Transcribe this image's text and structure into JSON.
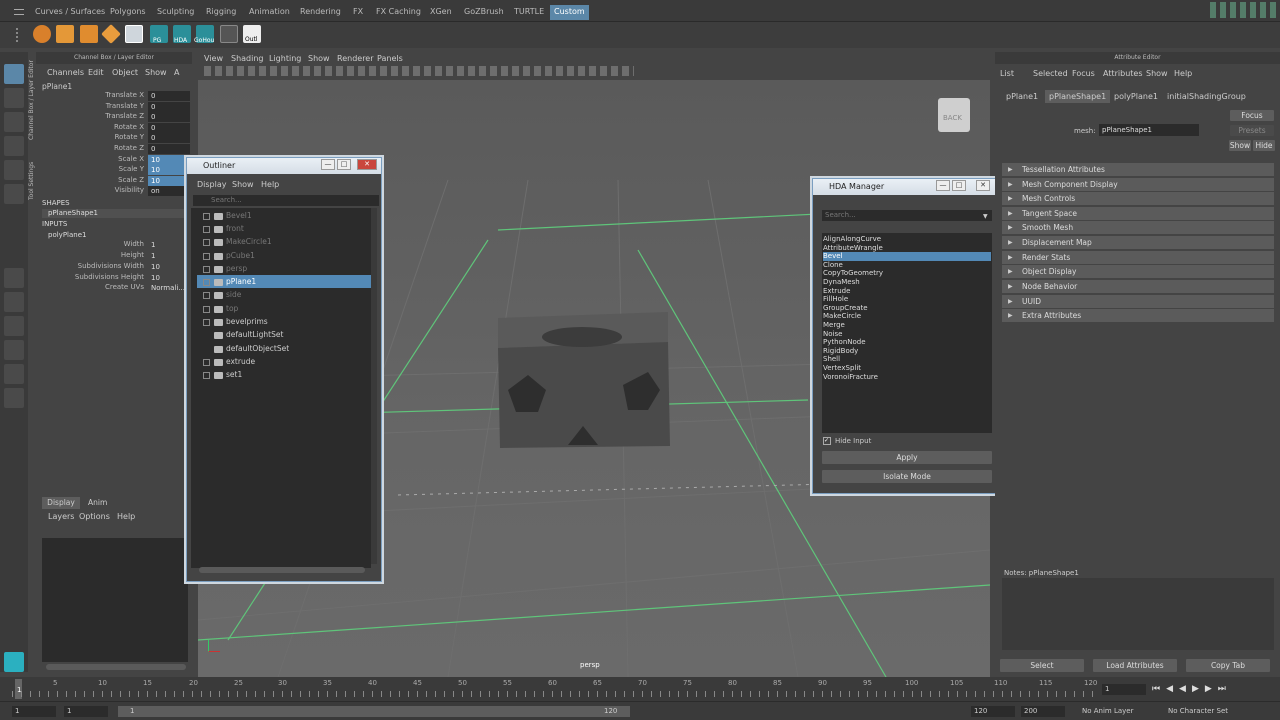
{
  "shelf": {
    "tabs": [
      "Curves / Surfaces",
      "Polygons",
      "Sculpting",
      "Rigging",
      "Animation",
      "Rendering",
      "FX",
      "FX Caching",
      "XGen",
      "GoZBrush",
      "TURTLE",
      "Custom"
    ],
    "icon_labels": {
      "pg": "PG",
      "hda": "HDA",
      "gohou": "GoHou",
      "outl": "Outl"
    }
  },
  "channel_box": {
    "header": "Channel Box / Layer Editor",
    "menu": [
      "Channels",
      "Edit",
      "Object",
      "Show",
      "A"
    ],
    "object": "pPlane1",
    "attrs": [
      {
        "label": "Translate X",
        "value": "0"
      },
      {
        "label": "Translate Y",
        "value": "0"
      },
      {
        "label": "Translate Z",
        "value": "0"
      },
      {
        "label": "Rotate X",
        "value": "0"
      },
      {
        "label": "Rotate Y",
        "value": "0"
      },
      {
        "label": "Rotate Z",
        "value": "0"
      },
      {
        "label": "Scale X",
        "value": "10"
      },
      {
        "label": "Scale Y",
        "value": "10"
      },
      {
        "label": "Scale Z",
        "value": "10"
      },
      {
        "label": "Visibility",
        "value": "on"
      }
    ],
    "shapes_label": "SHAPES",
    "shape_name": "pPlaneShape1",
    "inputs_label": "INPUTS",
    "input_name": "polyPlane1",
    "input_attrs": [
      {
        "label": "Width",
        "value": "1"
      },
      {
        "label": "Height",
        "value": "1"
      },
      {
        "label": "Subdivisions Width",
        "value": "10"
      },
      {
        "label": "Subdivisions Height",
        "value": "10"
      },
      {
        "label": "Create UVs",
        "value": "Normali..."
      }
    ],
    "layer_tabs": [
      "Display",
      "Anim"
    ],
    "layer_menu": [
      "Layers",
      "Options",
      "Help"
    ],
    "side_tabs": "Channel Box / Layer Editor",
    "tool_settings": "Tool Settings"
  },
  "viewport": {
    "menu": [
      "View",
      "Shading",
      "Lighting",
      "Show",
      "Renderer",
      "Panels"
    ],
    "camera": "persp",
    "cube_label": "BACK"
  },
  "outliner": {
    "title": "Outliner",
    "menu": [
      "Display",
      "Show",
      "Help"
    ],
    "search_placeholder": "Search...",
    "items": [
      {
        "name": "Bevel1",
        "state": "dim"
      },
      {
        "name": "front",
        "state": "dim"
      },
      {
        "name": "MakeCircle1",
        "state": "dim"
      },
      {
        "name": "pCube1",
        "state": "dim"
      },
      {
        "name": "persp",
        "state": "dim"
      },
      {
        "name": "pPlane1",
        "state": "sel"
      },
      {
        "name": "side",
        "state": "dim"
      },
      {
        "name": "top",
        "state": "dim"
      },
      {
        "name": "bevelprims",
        "state": ""
      },
      {
        "name": "defaultLightSet",
        "state": ""
      },
      {
        "name": "defaultObjectSet",
        "state": ""
      },
      {
        "name": "extrude",
        "state": ""
      },
      {
        "name": "set1",
        "state": ""
      }
    ]
  },
  "hda": {
    "title": "HDA Manager",
    "search_placeholder": "Search...",
    "items": [
      "AlignAlongCurve",
      "AttributeWrangle",
      "Bevel",
      "Clone",
      "CopyToGeometry",
      "DynaMesh",
      "Extrude",
      "FillHole",
      "GroupCreate",
      "MakeCircle",
      "Merge",
      "Noise",
      "PythonNode",
      "RigidBody",
      "Shell",
      "VertexSplit",
      "VoronoiFracture"
    ],
    "selected": "Bevel",
    "hide_input": "Hide Input",
    "apply": "Apply",
    "isolate": "Isolate Mode"
  },
  "attr_editor": {
    "header": "Attribute Editor",
    "menu": [
      "List",
      "Selected",
      "Focus",
      "Attributes",
      "Show",
      "Help"
    ],
    "tabs": [
      "pPlane1",
      "pPlaneShape1",
      "polyPlane1",
      "initialShadingGroup"
    ],
    "mesh_label": "mesh:",
    "mesh_value": "pPlaneShape1",
    "focus": "Focus",
    "presets": "Presets",
    "show": "Show",
    "hide": "Hide",
    "sections": [
      "Tessellation Attributes",
      "Mesh Component Display",
      "Mesh Controls",
      "Tangent Space",
      "Smooth Mesh",
      "Displacement Map",
      "Render Stats",
      "Object Display",
      "Node Behavior",
      "UUID",
      "Extra Attributes"
    ],
    "notes": "Notes:  pPlaneShape1",
    "buttons": [
      "Select",
      "Load Attributes",
      "Copy Tab"
    ]
  },
  "timeline": {
    "ticks": [
      "5",
      "10",
      "15",
      "20",
      "25",
      "30",
      "35",
      "40",
      "45",
      "50",
      "55",
      "60",
      "65",
      "70",
      "75",
      "80",
      "85",
      "90",
      "95",
      "100",
      "105",
      "110",
      "115",
      "120"
    ],
    "start_frame": "1",
    "current_frame": "1"
  },
  "range": {
    "start": "1",
    "start2": "1",
    "slider_start": "1",
    "slider_end": "120",
    "end": "120",
    "end2": "200",
    "anim_layer": "No Anim Layer",
    "char_set": "No Character Set"
  }
}
